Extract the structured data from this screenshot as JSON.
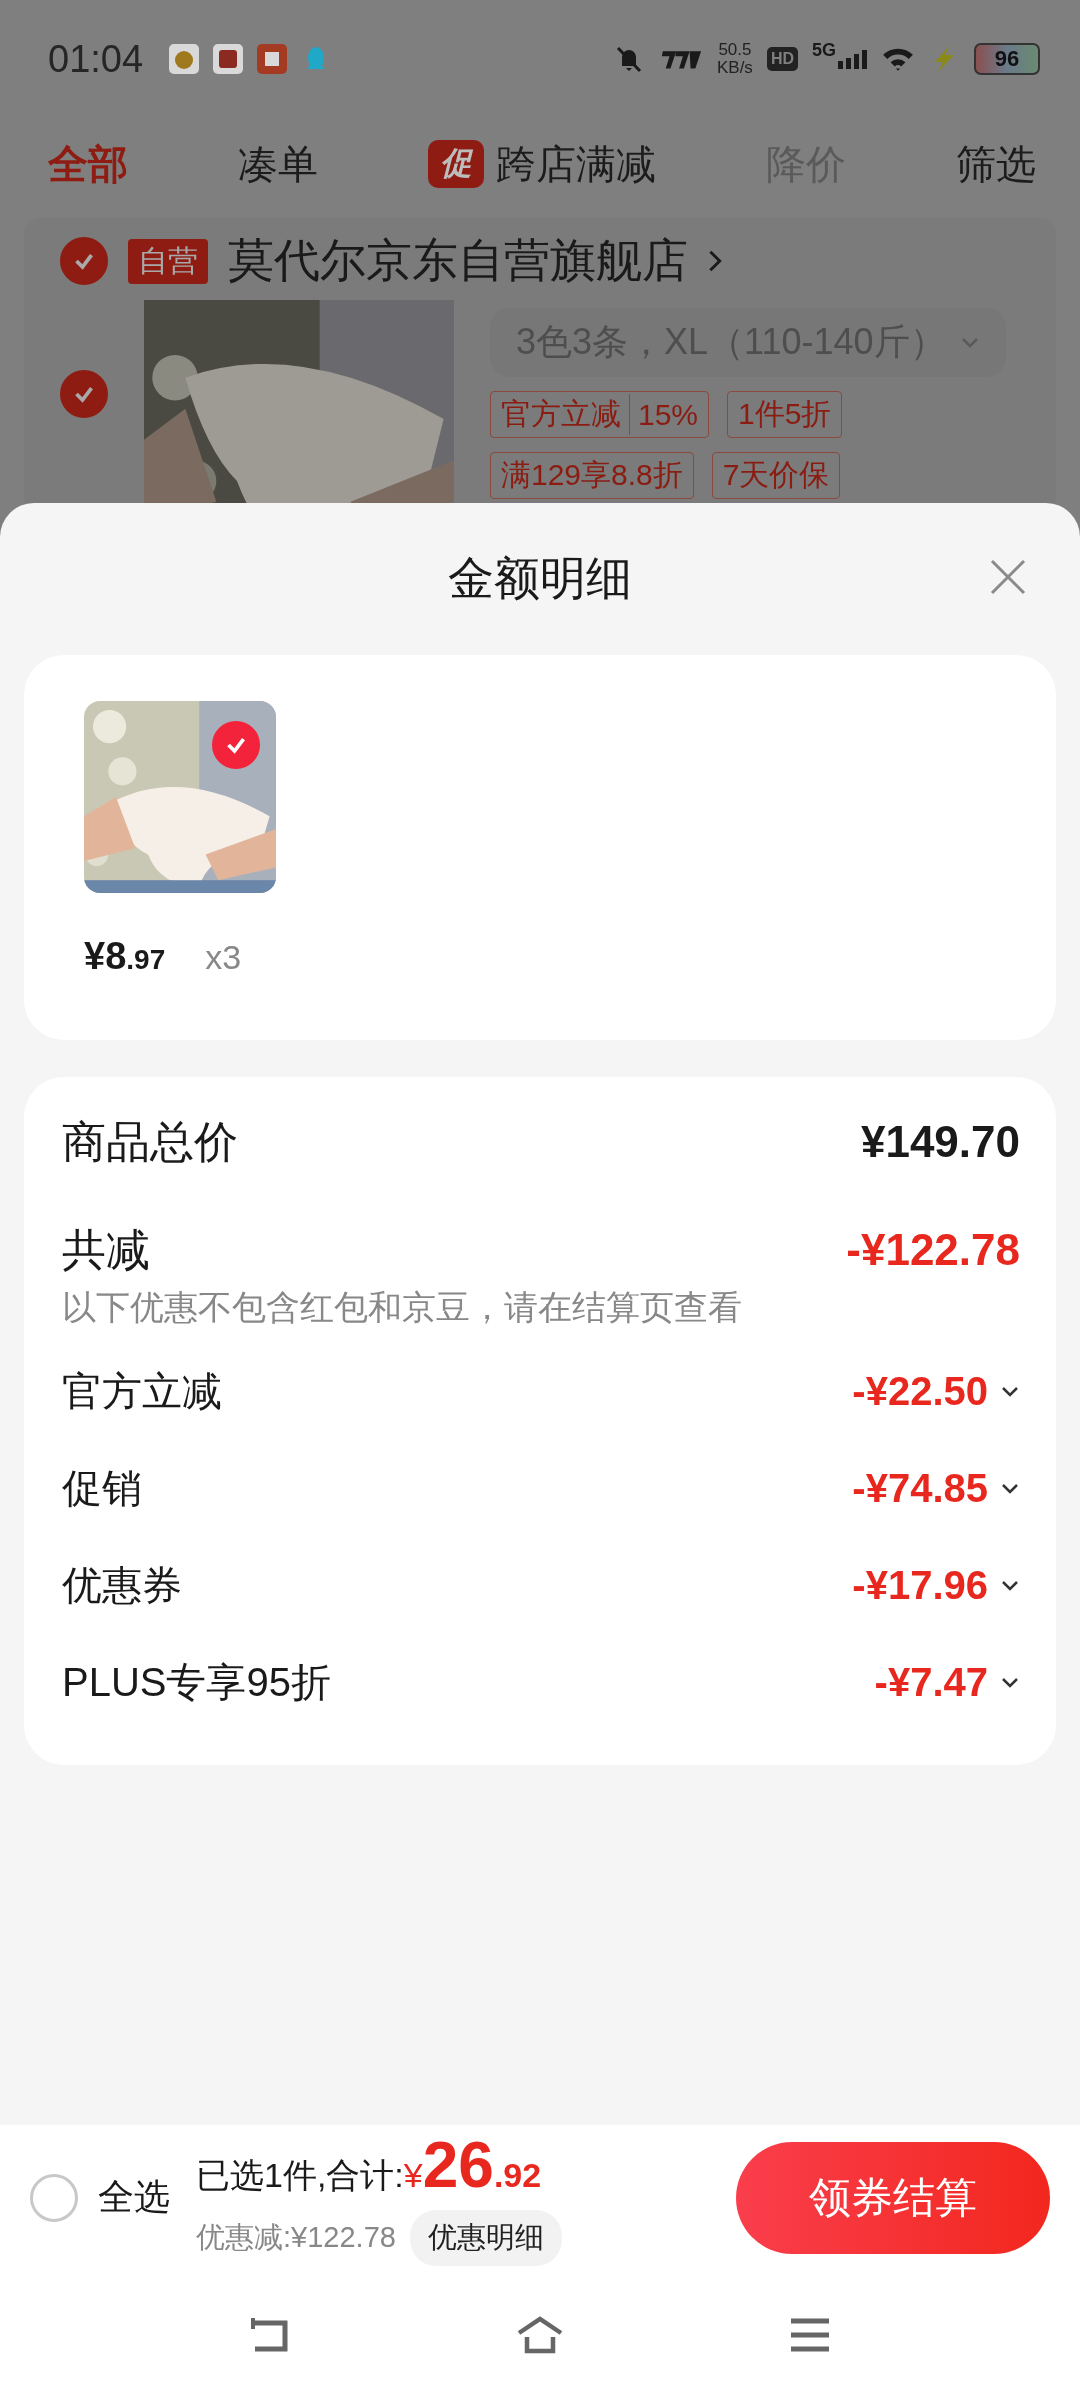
{
  "status_bar": {
    "time": "01:04",
    "speed": "50.5",
    "speed_unit": "KB/s",
    "hd": "HD",
    "network": "5G",
    "battery": "96"
  },
  "tabs": [
    {
      "label": "全部",
      "selected": true,
      "disabled": false
    },
    {
      "label": "凑单",
      "selected": false,
      "disabled": false
    },
    {
      "label": "跨店满减",
      "badge": "促",
      "selected": false,
      "disabled": false
    },
    {
      "label": "降价",
      "selected": false,
      "disabled": true
    },
    {
      "label": "筛选",
      "selected": false,
      "disabled": false
    }
  ],
  "store": {
    "checked": true,
    "tag": "自营",
    "name": "莫代尔京东自营旗舰店",
    "product": {
      "checked": true,
      "variant": "3色3条，XL（110-140斤）",
      "tags": [
        {
          "label": "官方立减",
          "value": "15%"
        },
        {
          "label": "1件5折"
        },
        {
          "label": "满129享8.8折"
        },
        {
          "label": "7天价保"
        }
      ]
    }
  },
  "sheet": {
    "title": "金额明细",
    "items": [
      {
        "checked": true,
        "currency": "¥",
        "price": "8",
        "decimals": ".97",
        "quantity": "x3"
      }
    ],
    "summary": {
      "total_label": "商品总价",
      "total_value": "¥149.70",
      "reduction_label": "共减",
      "reduction_value": "-¥122.78",
      "reduction_note": "以下优惠不包含红包和京豆，请在结算页查看",
      "rows": [
        {
          "label": "官方立减",
          "value": "-¥22.50",
          "expanded": false
        },
        {
          "label": "促销",
          "value": "-¥74.85",
          "expanded": false
        },
        {
          "label": "优惠券",
          "value": "-¥17.96",
          "expanded": false
        },
        {
          "label": "PLUS专享95折",
          "value": "-¥7.47",
          "expanded": false
        }
      ]
    }
  },
  "bottom_bar": {
    "select_all_checked": false,
    "select_all_label": "全选",
    "selected_text": "已选1件,合计:",
    "currency": "¥",
    "total": "26",
    "total_decimals": ".92",
    "discount": "优惠减:¥122.78",
    "details_button": "优惠明细",
    "checkout_button": "领券结算"
  }
}
